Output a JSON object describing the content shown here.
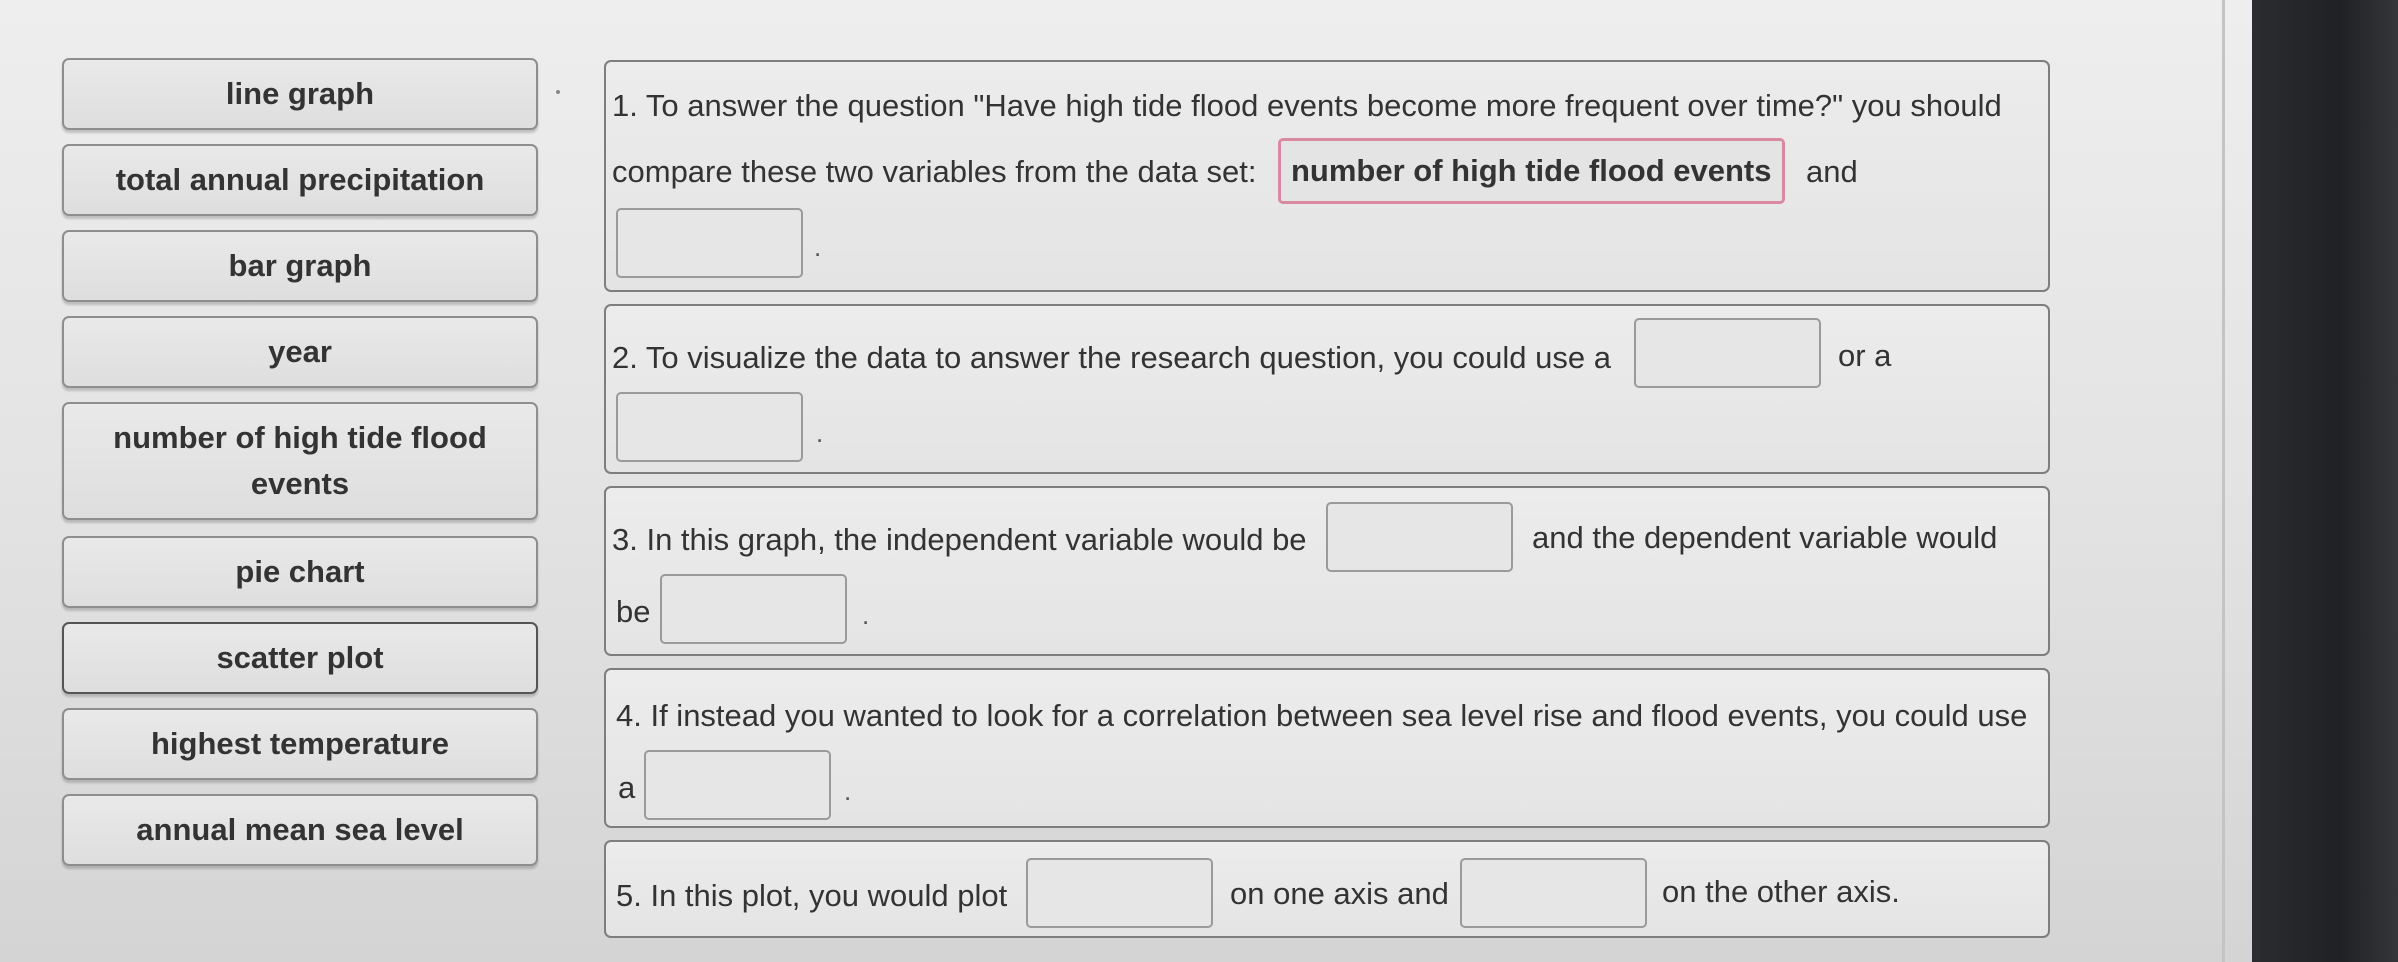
{
  "options": [
    "line graph",
    "total annual precipitation",
    "bar graph",
    "year",
    "number of high tide flood events",
    "pie chart",
    "scatter plot",
    "highest temperature",
    "annual mean sea level"
  ],
  "questions": {
    "q1": {
      "line1": "1. To answer the question \"Have high tide flood events become more frequent over time?\" you should",
      "line2_prefix": "compare these two variables from the data set:",
      "filled_answer": "number of high tide flood events",
      "connector": "and",
      "end_punct": "."
    },
    "q2": {
      "prefix": "2. To visualize the data to answer the research question, you could use a",
      "connector": "or a",
      "end_punct": "."
    },
    "q3": {
      "prefix": "3. In this graph, the independent variable would be",
      "connector": "and the dependent variable would",
      "line2_prefix": "be",
      "end_punct": "."
    },
    "q4": {
      "line1": "4. If instead you wanted to look for a correlation between sea level rise and flood events, you could use",
      "line2_prefix": "a",
      "end_punct": "."
    },
    "q5": {
      "prefix": "5. In this plot, you would plot",
      "connector": "on one axis and",
      "suffix": "on the other axis."
    }
  }
}
